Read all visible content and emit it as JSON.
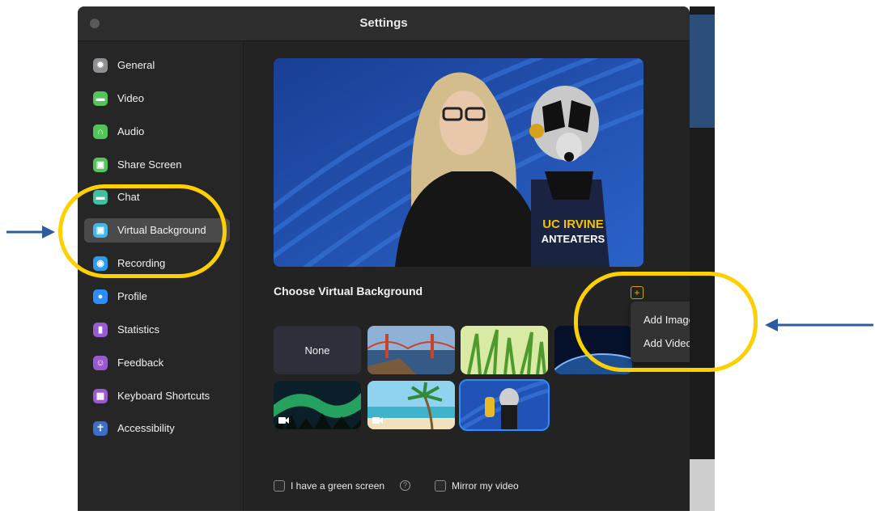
{
  "window": {
    "title": "Settings"
  },
  "sidebar": {
    "items": [
      {
        "label": "General",
        "icon": "gear-icon",
        "color": "#8e8e93"
      },
      {
        "label": "Video",
        "icon": "video-camera-icon",
        "color": "#52c45a"
      },
      {
        "label": "Audio",
        "icon": "headphones-icon",
        "color": "#52c45a"
      },
      {
        "label": "Share Screen",
        "icon": "share-screen-icon",
        "color": "#52c45a"
      },
      {
        "label": "Chat",
        "icon": "chat-bubble-icon",
        "color": "#3fc0a0"
      },
      {
        "label": "Virtual Background",
        "icon": "person-portrait-icon",
        "color": "#42b8e6",
        "selected": true
      },
      {
        "label": "Recording",
        "icon": "record-icon",
        "color": "#2d9cf0"
      },
      {
        "label": "Profile",
        "icon": "profile-icon",
        "color": "#2d8cff"
      },
      {
        "label": "Statistics",
        "icon": "bar-chart-icon",
        "color": "#9b59d0"
      },
      {
        "label": "Feedback",
        "icon": "smiley-icon",
        "color": "#9b59d0"
      },
      {
        "label": "Keyboard Shortcuts",
        "icon": "keyboard-icon",
        "color": "#9b59d0"
      },
      {
        "label": "Accessibility",
        "icon": "accessibility-icon",
        "color": "#3e6ec8"
      }
    ]
  },
  "main": {
    "section_title": "Choose Virtual Background",
    "add_menu": {
      "items": [
        "Add Image",
        "Add Video"
      ]
    },
    "thumbnails": [
      {
        "name": "None",
        "label": "None"
      },
      {
        "name": "golden-gate-bridge"
      },
      {
        "name": "grass"
      },
      {
        "name": "earth-from-space"
      },
      {
        "name": "aurora",
        "video": true
      },
      {
        "name": "beach-palm",
        "video": true
      },
      {
        "name": "uc-irvine-anteater",
        "selected": true
      }
    ],
    "green_screen_label": "I have a green screen",
    "mirror_label": "Mirror my video"
  },
  "preview": {
    "shirt_text_line1": "UC IRVINE",
    "shirt_text_line2": "ANTEATERS"
  },
  "annotations": {
    "highlight_color": "#ffd000",
    "arrow_color": "#2e5d9f"
  },
  "accent_color": "#2d8cff"
}
